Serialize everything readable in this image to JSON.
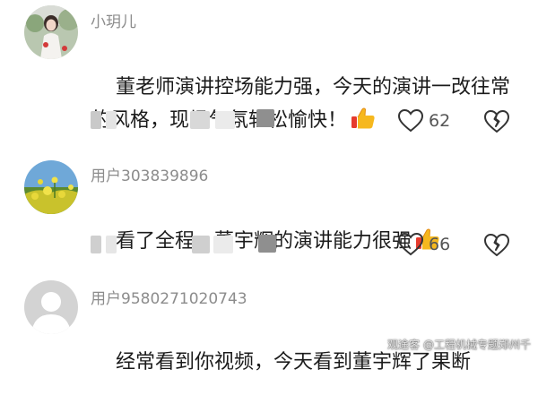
{
  "comments": [
    {
      "username": "小玥儿",
      "text": "董老师演讲控场能力强，今天的演讲一改往常的风格，现场气氛轻松愉快！",
      "likes": "62",
      "emoji": "thumbs-up-icon"
    },
    {
      "username": "用户303839896",
      "text": "看了全程，董宇辉的演讲能力很强",
      "likes": "66",
      "emoji": "thumbs-up-icon"
    },
    {
      "username": "用户9580271020743",
      "text": "经常看到你视频，今天看到董宇辉了果断",
      "likes": "",
      "emoji": ""
    }
  ],
  "watermark": "观途客 @工程机械专题郑州千"
}
